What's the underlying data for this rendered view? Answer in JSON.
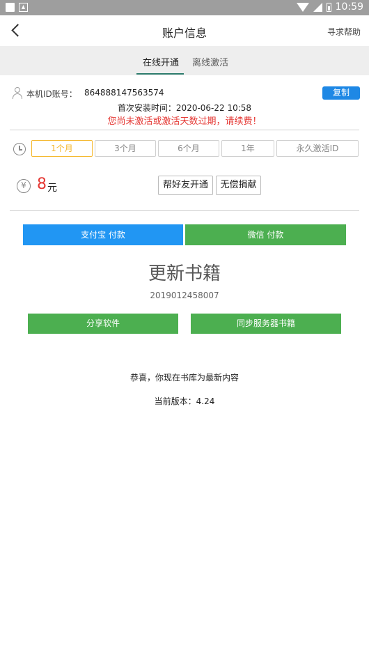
{
  "status_bar": {
    "time": "10:59",
    "icons": [
      "square-icon",
      "notification-icon",
      "wifi-icon",
      "signal-icon",
      "battery-icon"
    ]
  },
  "header": {
    "title": "账户信息",
    "help_label": "寻求帮助",
    "back_icon": "chevron-left-icon"
  },
  "tabs": [
    {
      "label": "在线开通",
      "active": true
    },
    {
      "label": "离线激活",
      "active": false
    }
  ],
  "account": {
    "id_label": "本机ID账号：",
    "id_value": "864888147563574",
    "copy_label": "复制",
    "install_time": "首次安装时间：2020-06-22 10:58",
    "expired_notice": "您尚未激活或激活天数过期，请续费！"
  },
  "plans": {
    "options": [
      "1个月",
      "3个月",
      "6个月",
      "1年",
      "永久激活ID"
    ],
    "selected_index": 0
  },
  "price": {
    "currency_symbol": "¥",
    "value": "8",
    "unit": "元",
    "help_friend_label": "帮好友开通",
    "donate_label": "无偿捐献"
  },
  "payment": {
    "alipay_label": "支付宝 付款",
    "wechat_label": "微信 付款"
  },
  "update": {
    "title": "更新书籍",
    "id": "2019012458007",
    "share_label": "分享软件",
    "sync_label": "同步服务器书籍",
    "message": "恭喜，你现在书库为最新内容",
    "version": "当前版本：4.24"
  },
  "colors": {
    "accent_blue": "#1e88e5",
    "accent_green": "#4caf50",
    "warning_red": "#e53935",
    "selected_yellow": "#f5b82e"
  }
}
